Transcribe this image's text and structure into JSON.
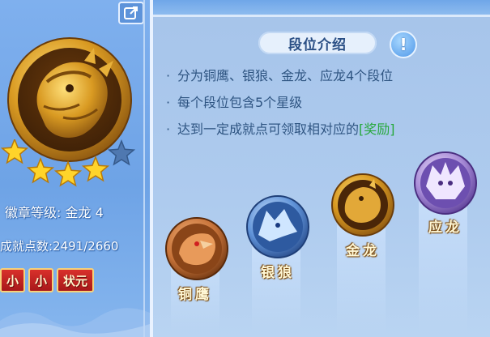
{
  "left_panel": {
    "badge_level_label": "徽章等级: 金龙 4",
    "points_label": "成就点数:2491/2660",
    "stars_filled": 4,
    "stars_total": 5,
    "title_tags": [
      "小",
      "小",
      "状元"
    ]
  },
  "info": {
    "title": "段位介绍",
    "info_icon_glyph": "!",
    "lines": [
      "分为铜鹰、银狼、金龙、应龙4个段位",
      "每个段位包含5个星级",
      "达到一定成就点可领取相对应的"
    ],
    "reward_link": "[奖励]"
  },
  "ranks": [
    {
      "name": "铜鹰",
      "color": "#c8743a"
    },
    {
      "name": "银狼",
      "color": "#5f92d8"
    },
    {
      "name": "金龙",
      "color": "#d6a232"
    },
    {
      "name": "应龙",
      "color": "#a68ad6"
    }
  ],
  "colors": {
    "reward": "#27a83c",
    "tag_bg": "#c42422"
  }
}
